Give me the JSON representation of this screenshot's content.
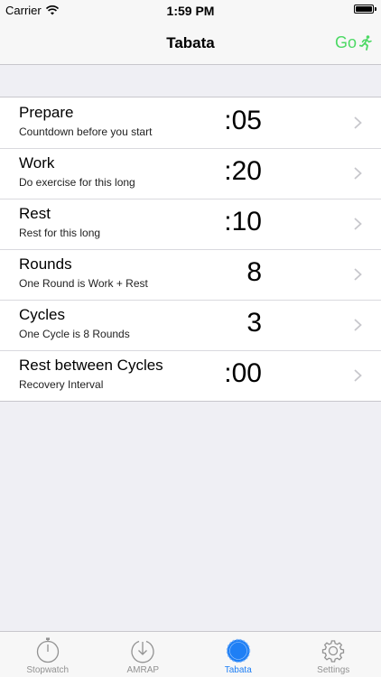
{
  "status_bar": {
    "carrier": "Carrier",
    "time": "1:59 PM"
  },
  "nav": {
    "title": "Tabata",
    "go_label": "Go"
  },
  "rows": [
    {
      "title": "Prepare",
      "subtitle": "Countdown before you start",
      "value": ":05"
    },
    {
      "title": "Work",
      "subtitle": "Do exercise for this long",
      "value": ":20"
    },
    {
      "title": "Rest",
      "subtitle": "Rest for this long",
      "value": ":10"
    },
    {
      "title": "Rounds",
      "subtitle": "One Round is Work + Rest",
      "value": "8"
    },
    {
      "title": "Cycles",
      "subtitle": "One Cycle is 8 Rounds",
      "value": "3"
    },
    {
      "title": "Rest between Cycles",
      "subtitle": "Recovery Interval",
      "value": ":00"
    }
  ],
  "tabs": [
    {
      "label": "Stopwatch",
      "icon": "stopwatch-icon"
    },
    {
      "label": "AMRAP",
      "icon": "amrap-icon"
    },
    {
      "label": "Tabata",
      "icon": "tabata-icon",
      "active": true
    },
    {
      "label": "Settings",
      "icon": "gear-icon"
    }
  ],
  "colors": {
    "accent_green": "#4cd964",
    "tint_blue": "#1e7ff5",
    "inactive_gray": "#929292"
  }
}
